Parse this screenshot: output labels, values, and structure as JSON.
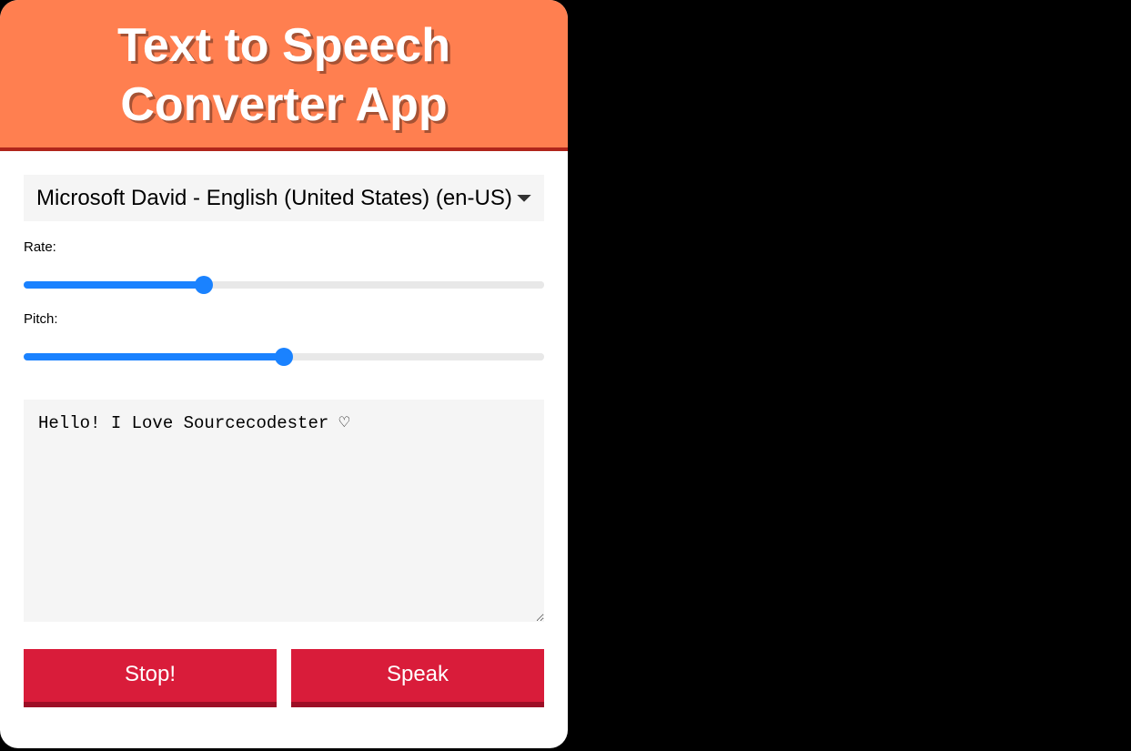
{
  "header": {
    "title": "Text to Speech Converter App"
  },
  "voice": {
    "selected": "Microsoft David - English (United States) (en-US)"
  },
  "rate": {
    "label": "Rate:",
    "value": 34,
    "min": 0,
    "max": 100
  },
  "pitch": {
    "label": "Pitch:",
    "value": 50,
    "min": 0,
    "max": 100
  },
  "text": {
    "value": "Hello! I Love Sourcecodester ♡"
  },
  "buttons": {
    "stop": "Stop!",
    "speak": "Speak"
  }
}
